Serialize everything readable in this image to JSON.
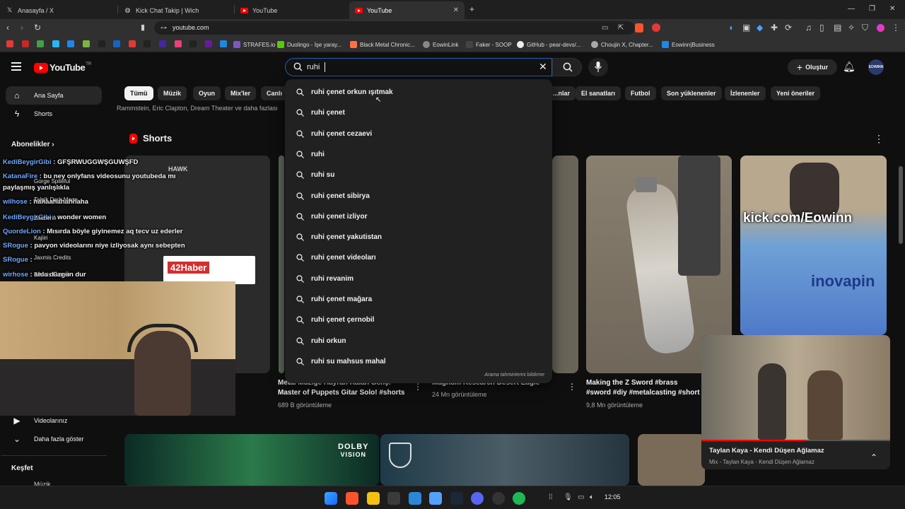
{
  "browser": {
    "tabs": [
      {
        "title": "Anasayfa / X",
        "icon": "x-logo-icon"
      },
      {
        "title": "Kick Chat Takip | Wich",
        "icon": "globe-icon"
      },
      {
        "title": "YouTube",
        "icon": "youtube-icon"
      },
      {
        "title": "YouTube",
        "icon": "youtube-icon",
        "active": true
      }
    ],
    "url": "youtube.com",
    "bookmarks": [
      {
        "label": "STRAFES.io"
      },
      {
        "label": "Duolingo - İşe yaray..."
      },
      {
        "label": "Black Metal Chronic..."
      },
      {
        "label": "EowinLink"
      },
      {
        "label": "Faker - SOOP"
      },
      {
        "label": "GitHub - pear-devs/..."
      },
      {
        "label": "Choujin X, Chapter..."
      },
      {
        "label": "Eowinn|Business"
      }
    ],
    "bookmark_icon_colors": [
      "#e53935",
      "#c62828",
      "#43a047",
      "#29b6f6",
      "#1e88e5",
      "#7cb342",
      "#222222",
      "#1565c0",
      "#e53935",
      "#222222",
      "#4527a0",
      "#ec407a",
      "#222222",
      "#6a1b9a",
      "#1e88e5"
    ]
  },
  "youtube": {
    "logo_text": "YouTube",
    "logo_sup": "TR",
    "search": {
      "query": "ruhi"
    },
    "create_label": "Oluştur",
    "avatar_text": "EOWINN",
    "chips": [
      "Tümü",
      "Müzik",
      "Oyun",
      "Mix'ler",
      "Canlı",
      "...nlar",
      "El sanatları",
      "Futbol",
      "Son yüklenenler",
      "İzlenenler",
      "Yeni öneriler"
    ],
    "suggestions": [
      "ruhi çenet orkun ışıtmak",
      "ruhi çenet",
      "ruhi çenet cezaevi",
      "ruhi",
      "ruhi su",
      "ruhi çenet sibirya",
      "ruhi çenet izliyor",
      "ruhi çenet yakutistan",
      "ruhi çenet videoları",
      "ruhi revanim",
      "ruhi çenet mağara",
      "ruhi çenet çernobil",
      "ruhi orkun",
      "ruhi su mahsus mahal"
    ],
    "suggestions_footer": "Arama tahminlerini bildirme",
    "sidebar": {
      "items": [
        {
          "label": "Ana Sayfa"
        },
        {
          "label": "Shorts"
        }
      ],
      "subs_header": "Abonelikler",
      "lower_items": [
        {
          "label": "Videolarınız"
        },
        {
          "label": "Daha fazla göster"
        }
      ],
      "explore_header": "Keşfet",
      "explore_first": "Müzik"
    },
    "partial_text": "Rammstein, Eric Clapton, Dream Theater ve daha fazlası",
    "shorts_header": "Shorts",
    "shorts": [
      {
        "title": "Metal Müziğe Hayran Kalan Genç: Master of Puppets Gitar Solo! #shorts",
        "meta": "689 B görüntüleme"
      },
      {
        "title": "Magnum Research Desert Eagle",
        "meta": "24 Mn görüntüleme"
      },
      {
        "title": "Making the Z Sword #brass #sword #diy #metalcasting #short",
        "meta": "9,8 Mn görüntüleme"
      }
    ],
    "thumb_text_kick": "kick.com/Eowinn",
    "thumb_text_inovap": "inovapin",
    "thumb_text_42haber": "42Haber",
    "thumb_text_hawk": "HAWK",
    "miniplayer": {
      "title": "Taylan Kaya - Kendi Düşen Ağlamaz",
      "subtitle": "Mix - Taylan Kaya - Kendi Düşen Ağlamaz",
      "progress": 0.55
    },
    "banner_texts": {
      "dolby1": "DOLBY",
      "dolby2": "VISION"
    }
  },
  "stream_chat": [
    {
      "user": "KediBeygirGibi",
      "msg": ": GFŞRWUGGWŞGUWŞFD"
    },
    {
      "user": "KatanaFire",
      "msg": ": bu ney onlyfans videosunu youtubeda mı"
    },
    {
      "user": "",
      "msg": "paylaşmış yanlışlıkla"
    },
    {
      "user": "wilhose",
      "msg": ": hahaahahahhaha"
    },
    {
      "user": "KediBeygirGibi",
      "msg": ": wonder women"
    },
    {
      "user": "QuordeLion",
      "msg": ": Mısırda böyle giyinemez aq tecv uz ederler"
    },
    {
      "user": "SRogue",
      "msg": ": pavyon videolarını niye izliyosak aynı sebepten"
    },
    {
      "user": "SRogue",
      "msg": ":"
    },
    {
      "user": "wirhose",
      "msg": ": ahla düzgün dur"
    }
  ],
  "stream_chat_names": [
    "Gorge Spiteful",
    "Talgik Dark Mage",
    "Zauberin",
    "Kajiiri",
    "Jaxmis Credits",
    "Beduis Gamer"
  ],
  "taskbar": {
    "time": "12:05"
  }
}
